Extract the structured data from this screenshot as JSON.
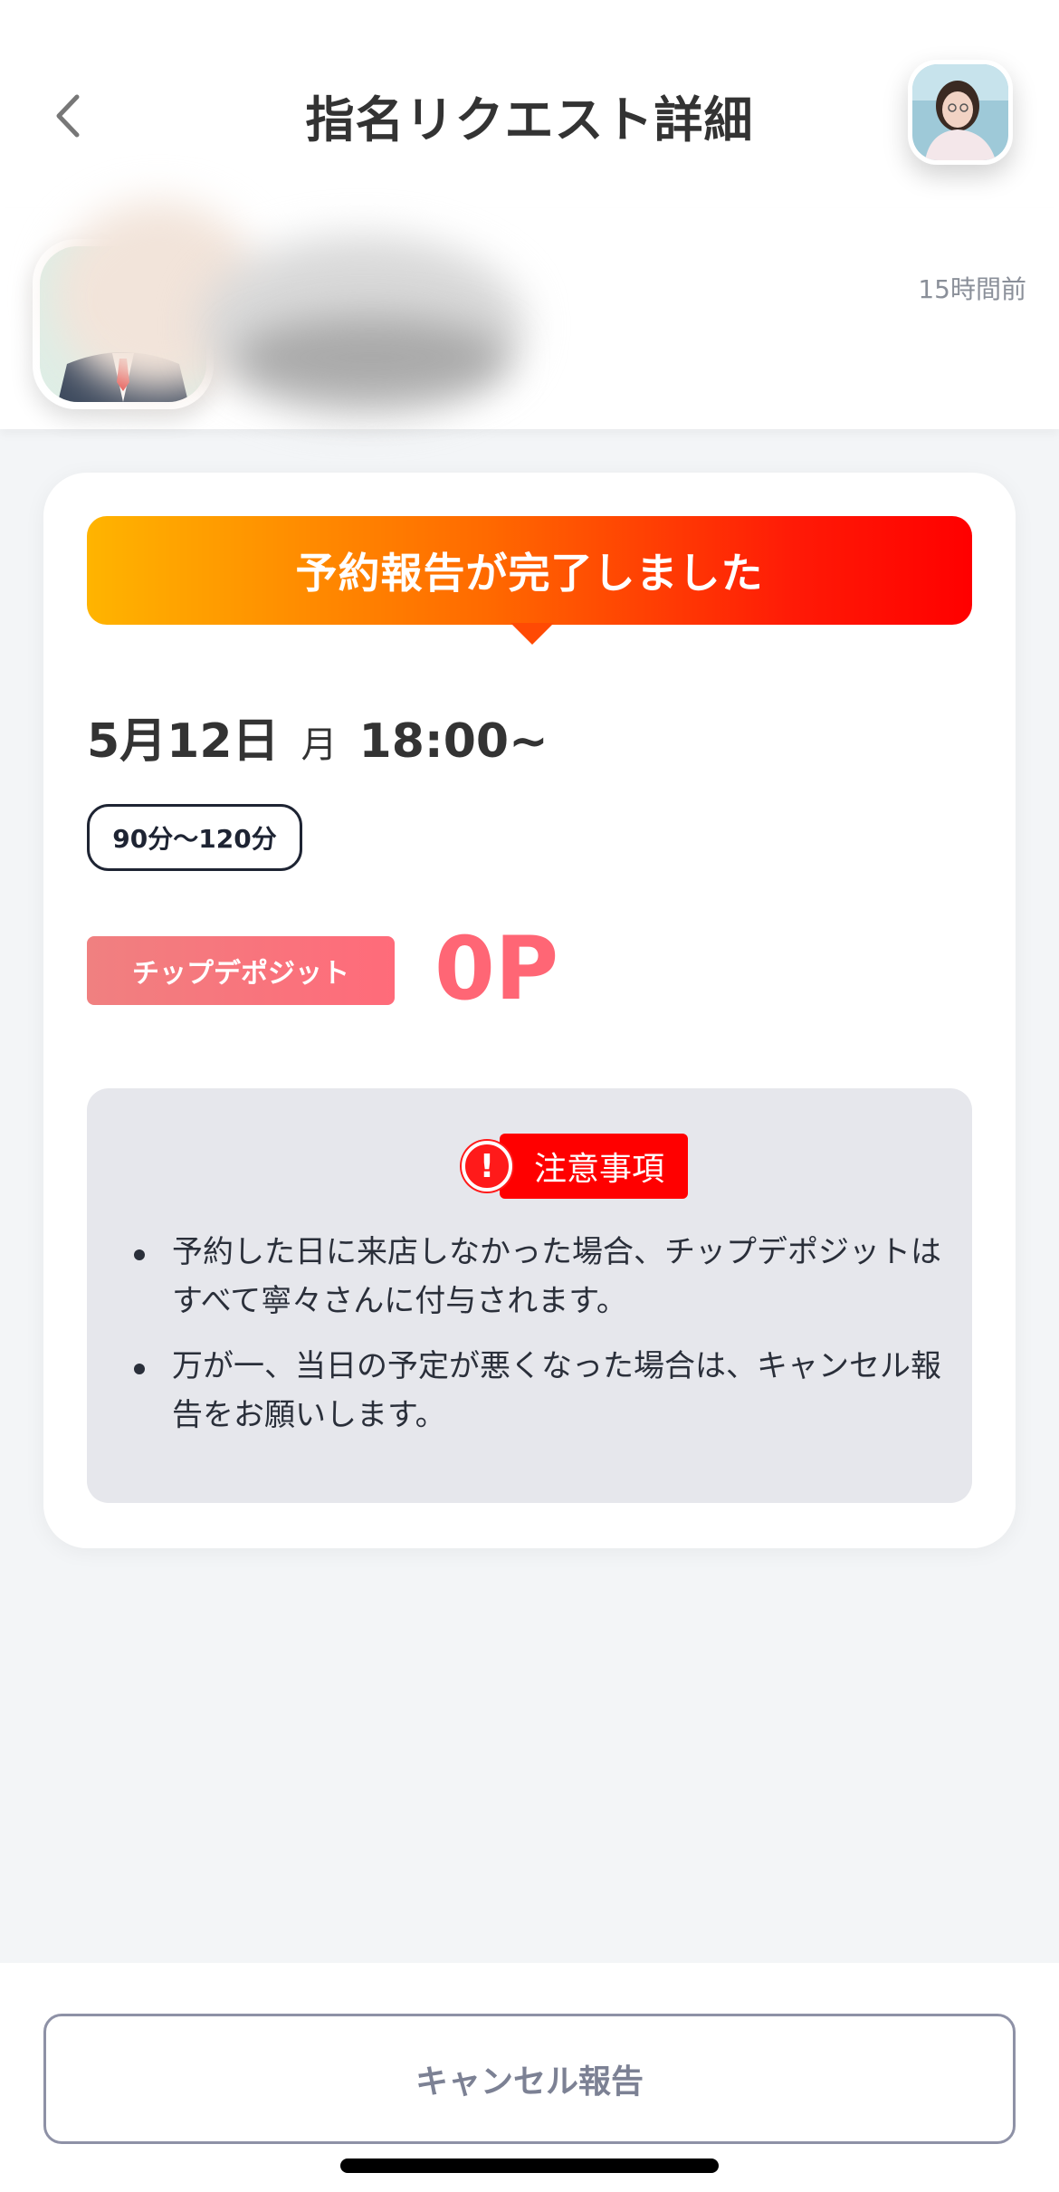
{
  "header": {
    "title": "指名リクエスト詳細"
  },
  "profile": {
    "time_ago": "15時間前"
  },
  "card": {
    "banner_text": "予約報告が完了しました",
    "date": "5月12日",
    "weekday": "月",
    "time": "18:00~",
    "duration": "90分〜120分",
    "deposit_label": "チップデポジット",
    "deposit_value": "0P"
  },
  "notice": {
    "title": "注意事項",
    "icon_glyph": "!",
    "items": [
      "予約した日に来店しなかった場合、チップデポジットはすべて寧々さんに付与されます。",
      "万が一、当日の予定が悪くなった場合は、キャンセル報告をお願いします。"
    ]
  },
  "footer": {
    "cancel_label": "キャンセル報告"
  },
  "colors": {
    "accent_red": "#ff0000",
    "banner_start": "#ffb400",
    "deposit_pink": "#ff6675"
  }
}
